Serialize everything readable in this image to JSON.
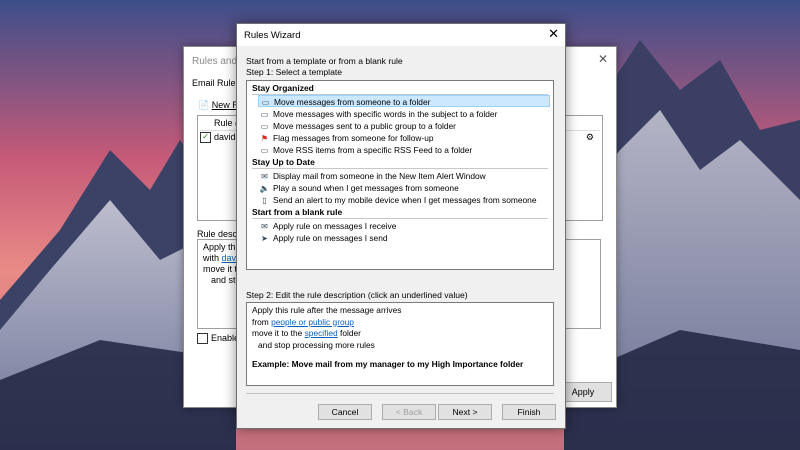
{
  "background_window": {
    "title": "Rules and A",
    "tab": "Email Rule",
    "new_rule": "New R",
    "column_header": "Rule (a",
    "rule_name": "davidn",
    "desc_label": "Rule desc",
    "desc_lines": [
      "Apply thi",
      "with",
      "dav",
      "move it t",
      "and sto"
    ],
    "enable_label": "Enable",
    "apply_label": "Apply"
  },
  "dialog": {
    "title": "Rules Wizard",
    "intro": "Start from a template or from a blank rule",
    "step1": "Step 1: Select a template",
    "groups": [
      {
        "name": "Stay Organized",
        "items": [
          {
            "label": "Move messages from someone to a folder",
            "icon": "move-to-folder-icon",
            "selected": true
          },
          {
            "label": "Move messages with specific words in the subject to a folder",
            "icon": "move-to-folder-icon"
          },
          {
            "label": "Move messages sent to a public group to a folder",
            "icon": "move-to-folder-icon"
          },
          {
            "label": "Flag messages from someone for follow-up",
            "icon": "flag-icon"
          },
          {
            "label": "Move RSS items from a specific RSS Feed to a folder",
            "icon": "rss-folder-icon"
          }
        ]
      },
      {
        "name": "Stay Up to Date",
        "items": [
          {
            "label": "Display mail from someone in the New Item Alert Window",
            "icon": "alert-window-icon"
          },
          {
            "label": "Play a sound when I get messages from someone",
            "icon": "speaker-icon"
          },
          {
            "label": "Send an alert to my mobile device when I get messages from someone",
            "icon": "mobile-phone-icon"
          }
        ]
      },
      {
        "name": "Start from a blank rule",
        "items": [
          {
            "label": "Apply rule on messages I receive",
            "icon": "envelope-icon"
          },
          {
            "label": "Apply rule on messages I send",
            "icon": "send-icon"
          }
        ]
      }
    ],
    "step2": "Step 2: Edit the rule description (click an underlined value)",
    "description": {
      "line1": "Apply this rule after the message arrives",
      "line2_prefix": "from",
      "line2_link": "people or public group",
      "line3_prefix": "move it to the",
      "line3_link": "specified",
      "line3_suffix": "folder",
      "line4": "and stop processing more rules",
      "example": "Example: Move mail from my manager to my High Importance folder"
    },
    "buttons": {
      "cancel": "Cancel",
      "back": "< Back",
      "next": "Next >",
      "finish": "Finish"
    }
  },
  "colors": {
    "selection": "#cce8ff",
    "link": "#0563c1",
    "dialog_bg": "#f0f0f0",
    "flag_red": "#d9261c"
  }
}
